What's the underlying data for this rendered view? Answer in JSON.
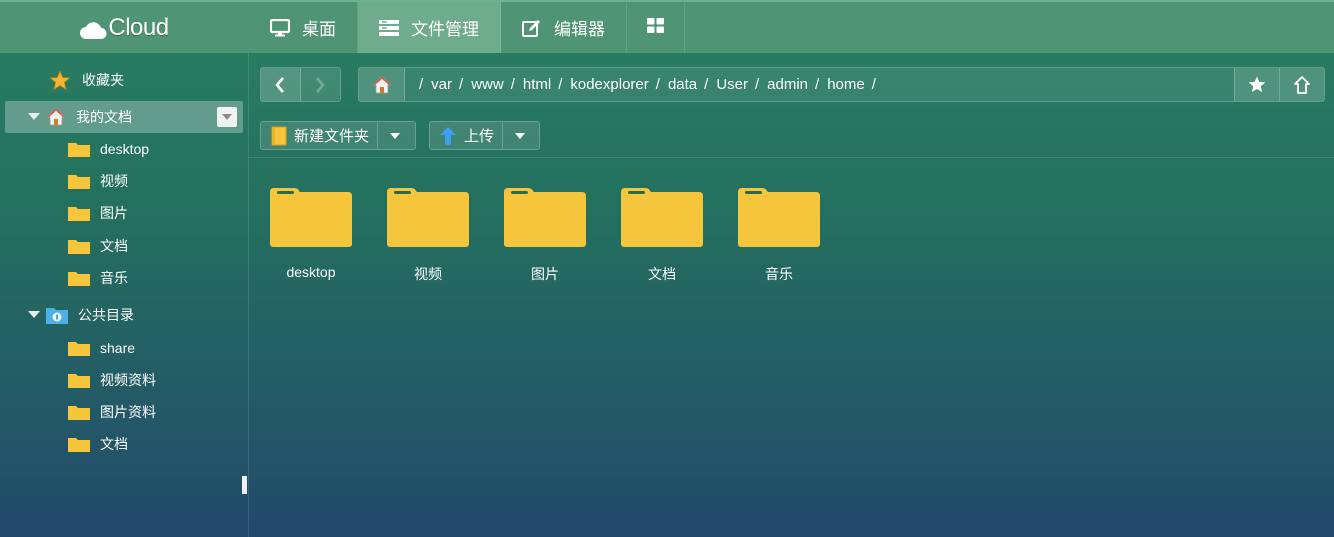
{
  "app": {
    "logo_text": "Cloud",
    "accent": "#4f9474",
    "folder_color": "#f5c53c"
  },
  "nav": {
    "tabs": [
      {
        "label": "桌面",
        "icon": "monitor-icon"
      },
      {
        "label": "文件管理",
        "icon": "drawer-icon"
      },
      {
        "label": "编辑器",
        "icon": "edit-icon"
      },
      {
        "label": "",
        "icon": "grid-icon"
      }
    ],
    "active_tab": "文件管理"
  },
  "sidebar": {
    "favorites": {
      "label": "收藏夹",
      "icon": "star-icon"
    },
    "my_docs": {
      "label": "我的文档",
      "icon": "home-icon",
      "children": [
        "desktop",
        "视频",
        "图片",
        "文档",
        "音乐"
      ]
    },
    "public": {
      "label": "公共目录",
      "icon": "public-folder-icon",
      "children": [
        "share",
        "视频资料",
        "图片资料",
        "文档"
      ]
    }
  },
  "toolbar": {
    "new_folder": "新建文件夹",
    "upload": "上传"
  },
  "path": {
    "segments": [
      "var",
      "www",
      "html",
      "kodexplorer",
      "data",
      "User",
      "admin",
      "home"
    ]
  },
  "files": [
    "desktop",
    "视频",
    "图片",
    "文档",
    "音乐"
  ]
}
